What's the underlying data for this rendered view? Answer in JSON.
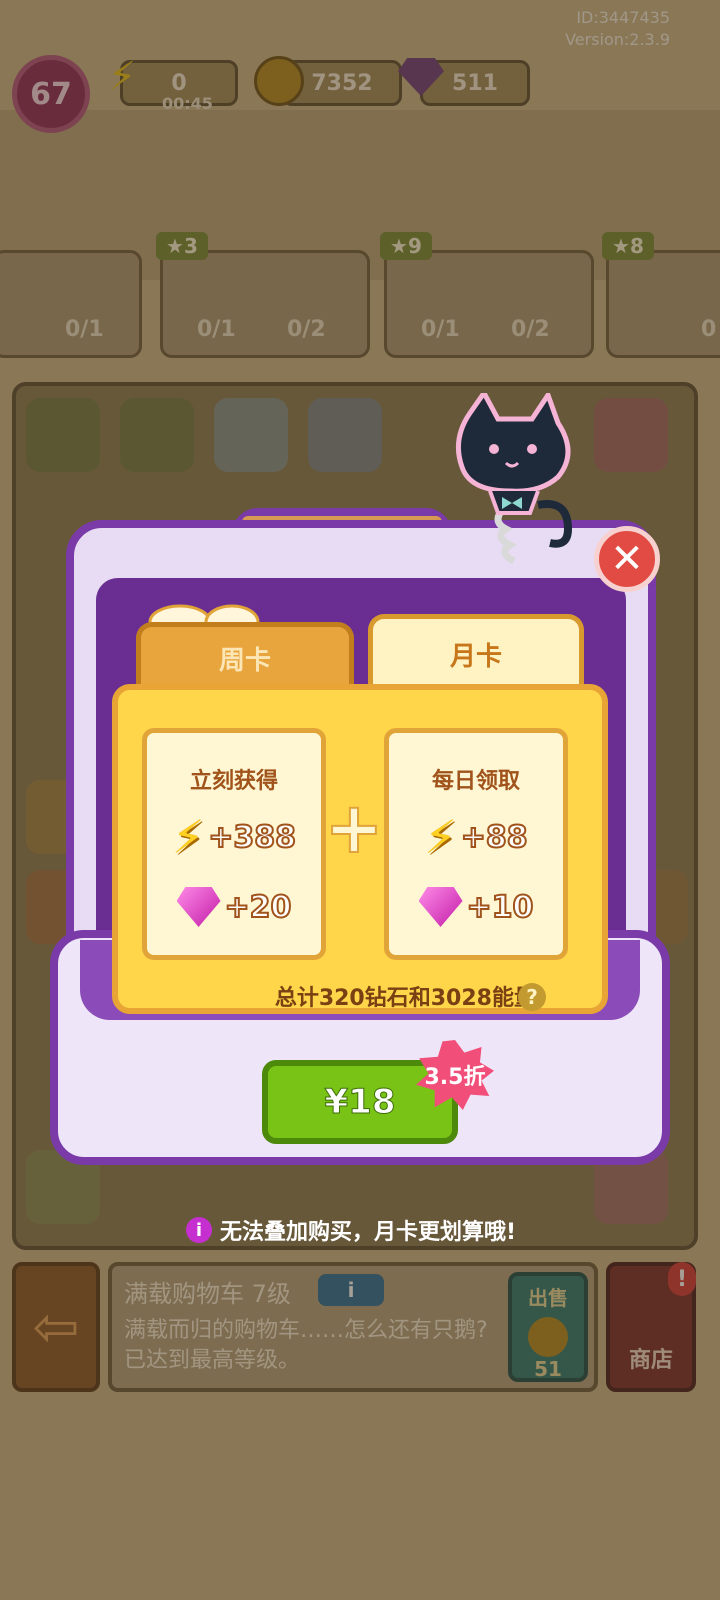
{
  "meta": {
    "id": "ID:3447435",
    "version": "Version:2.3.9"
  },
  "hud": {
    "level": "67",
    "energy": {
      "value": "0",
      "timer": "00:45"
    },
    "coins": "7352",
    "gems": "511"
  },
  "quests": [
    {
      "badge": "",
      "count": "0/1"
    },
    {
      "badge": "3",
      "counts": [
        "0/1",
        "0/2"
      ]
    },
    {
      "badge": "9",
      "counts": [
        "0/1",
        "0/2"
      ]
    },
    {
      "badge": "8",
      "count": "0"
    }
  ],
  "popup": {
    "tabs": [
      {
        "label": "周卡"
      },
      {
        "label": "月卡"
      }
    ],
    "instant": {
      "title": "立刻获得",
      "energy": "+388",
      "gems": "+20"
    },
    "daily": {
      "title": "每日领取",
      "energy": "+88",
      "gems": "+10"
    },
    "plus": "+",
    "total": "总计320钻石和3028能量!",
    "help": "?",
    "price": "¥18",
    "discount": "3.5折",
    "notice": "无法叠加购买，月卡更划算哦!",
    "close": "✕"
  },
  "info": {
    "title": "满载购物车 7级",
    "desc": "满载而归的购物车……怎么还有只鹅? 已达到最高等级。",
    "sell_label": "出售",
    "sell_value": "51",
    "shop_label": "商店",
    "shop_alert": "!"
  },
  "colors": {
    "purple": "#7a3aa7",
    "green": "#78c315",
    "gold": "#ffd54a",
    "close_red": "#e14b43"
  }
}
